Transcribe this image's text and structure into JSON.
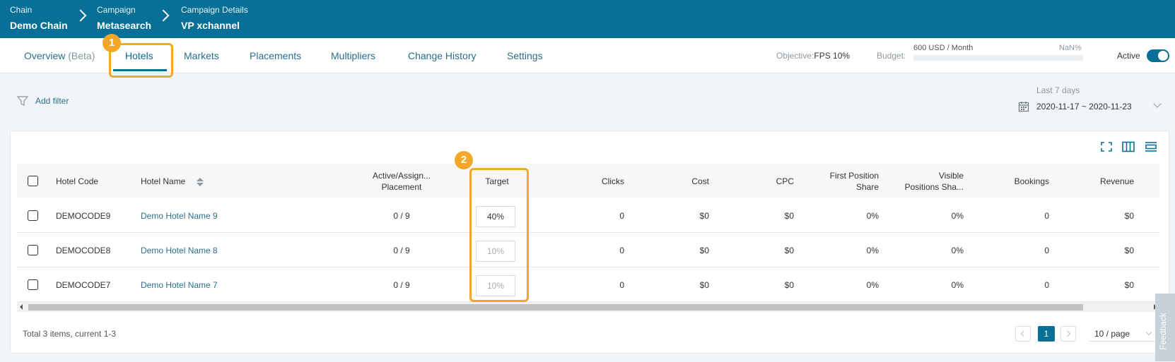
{
  "breadcrumb": [
    {
      "label": "Chain",
      "value": "Demo Chain"
    },
    {
      "label": "Campaign",
      "value": "Metasearch"
    },
    {
      "label": "Campaign Details",
      "value": "VP xchannel"
    }
  ],
  "tabs": {
    "overview": "Overview",
    "overview_suffix": "(Beta)",
    "hotels": "Hotels",
    "markets": "Markets",
    "placements": "Placements",
    "multipliers": "Multipliers",
    "change_history": "Change History",
    "settings": "Settings"
  },
  "annotations": {
    "badge1": "1",
    "badge2": "2"
  },
  "objective": {
    "label": "Objective:",
    "value": "FPS 10%"
  },
  "budget": {
    "label": "Budget:",
    "value": "600 USD / Month",
    "percent": "NaN%"
  },
  "status": {
    "label": "Active",
    "enabled": true
  },
  "filter": {
    "add_label": "Add filter"
  },
  "date_range": {
    "label": "Last 7 days",
    "value": "2020-11-17 ~ 2020-11-23"
  },
  "table": {
    "headers": {
      "hotel_code": "Hotel Code",
      "hotel_name": "Hotel Name",
      "placement_1": "Active/Assign...",
      "placement_2": "Placement",
      "target": "Target",
      "clicks": "Clicks",
      "cost": "Cost",
      "cpc": "CPC",
      "fps_1": "First Position",
      "fps_2": "Share",
      "vps_1": "Visible",
      "vps_2": "Positions Sha...",
      "bookings": "Bookings",
      "revenue": "Revenue"
    },
    "rows": [
      {
        "code": "DEMOCODE9",
        "name": "Demo Hotel Name 9",
        "placement": "0 / 9",
        "target": "40%",
        "clicks": "0",
        "cost": "$0",
        "cpc": "$0",
        "fps": "0%",
        "vps": "0%",
        "bookings": "0",
        "revenue": "$0"
      },
      {
        "code": "DEMOCODE8",
        "name": "Demo Hotel Name 8",
        "placement": "0 / 9",
        "target_placeholder": "10%",
        "clicks": "0",
        "cost": "$0",
        "cpc": "$0",
        "fps": "0%",
        "vps": "0%",
        "bookings": "0",
        "revenue": "$0"
      },
      {
        "code": "DEMOCODE7",
        "name": "Demo Hotel Name 7",
        "placement": "0 / 9",
        "target_placeholder": "10%",
        "clicks": "0",
        "cost": "$0",
        "cpc": "$0",
        "fps": "0%",
        "vps": "0%",
        "bookings": "0",
        "revenue": "$0"
      }
    ]
  },
  "pagination": {
    "total": "Total 3 items, current 1-3",
    "current": "1",
    "page_size": "10 / page"
  },
  "feedback": "Feedback"
}
